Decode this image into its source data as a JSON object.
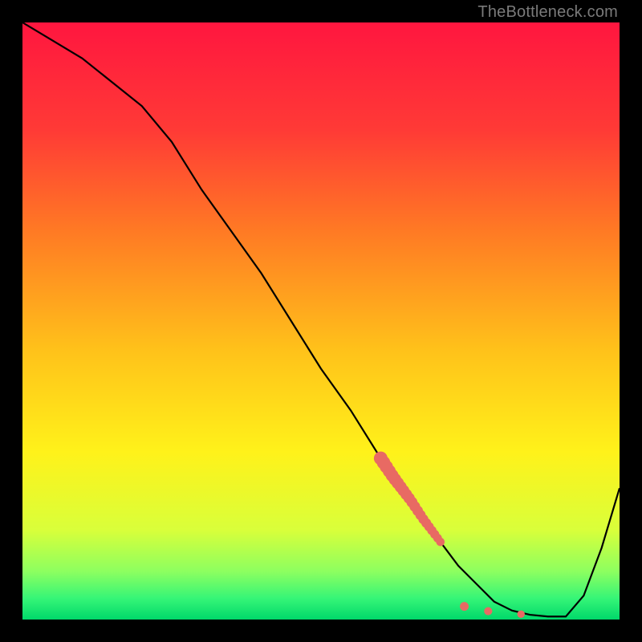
{
  "watermark": "TheBottleneck.com",
  "colors": {
    "background": "#000000",
    "gradient_top": "#ff163f",
    "gradient_upper_mid": "#ff6a2b",
    "gradient_mid": "#ffd21a",
    "gradient_lower_mid": "#f7ff1f",
    "gradient_near_bottom": "#6cff74",
    "gradient_bottom": "#00e06a",
    "curve": "#000000",
    "marker_fill": "#e86a63",
    "marker_stroke": "#c74a45",
    "watermark_text": "#7a7a7a"
  },
  "chart_data": {
    "type": "line",
    "title": "",
    "xlabel": "",
    "ylabel": "",
    "xlim": [
      0,
      100
    ],
    "ylim": [
      0,
      100
    ],
    "curve": {
      "x": [
        0,
        5,
        10,
        15,
        20,
        25,
        30,
        35,
        40,
        45,
        50,
        55,
        60,
        62,
        65,
        67,
        70,
        73,
        76,
        79,
        82,
        85,
        88,
        91,
        94,
        97,
        100
      ],
      "y": [
        100,
        97,
        94,
        90,
        86,
        80,
        72,
        65,
        58,
        50,
        42,
        35,
        27,
        24,
        20,
        17,
        13,
        9,
        6,
        3,
        1.5,
        0.8,
        0.5,
        0.5,
        4,
        12,
        22
      ]
    },
    "markers_dense": {
      "x_start": 60,
      "x_end": 70,
      "count": 22
    },
    "markers_sparse": {
      "x": [
        74,
        78,
        83.5
      ],
      "y": [
        2.2,
        1.4,
        0.9
      ]
    },
    "gradient_stops": [
      {
        "offset": 0.0,
        "color": "#ff163f"
      },
      {
        "offset": 0.18,
        "color": "#ff3a36"
      },
      {
        "offset": 0.35,
        "color": "#ff7a24"
      },
      {
        "offset": 0.55,
        "color": "#ffc21a"
      },
      {
        "offset": 0.72,
        "color": "#fff21a"
      },
      {
        "offset": 0.85,
        "color": "#d9ff3a"
      },
      {
        "offset": 0.92,
        "color": "#8cff60"
      },
      {
        "offset": 0.965,
        "color": "#35f577"
      },
      {
        "offset": 1.0,
        "color": "#00d86a"
      }
    ]
  }
}
